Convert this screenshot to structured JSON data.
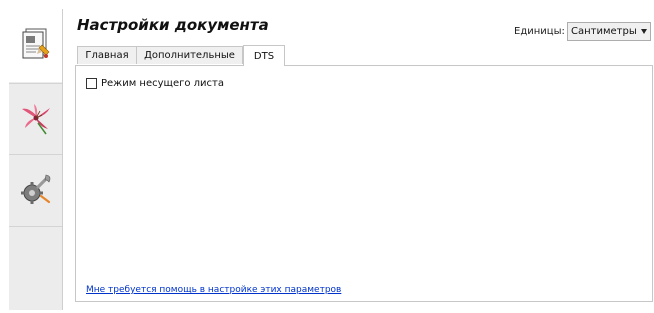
{
  "header": {
    "title": "Настройки документа",
    "units_label": "Единицы:",
    "units_value": "Сантиметры"
  },
  "tabs": [
    {
      "label": "Главная",
      "active": false
    },
    {
      "label": "Дополнительные",
      "active": false
    },
    {
      "label": "DTS",
      "active": true
    }
  ],
  "side_tabs": [
    {
      "icon": "document-icon",
      "active": true
    },
    {
      "icon": "lily-flower-icon",
      "active": false
    },
    {
      "icon": "gear-wrench-icon",
      "active": false
    }
  ],
  "panel": {
    "checkbox_label": "Режим несущего листа",
    "checkbox_checked": false,
    "help_link": "Мне требуется помощь в настройке этих параметров"
  },
  "colors": {
    "link": "#0033cc",
    "sidebar_bg": "#ececec",
    "tab_bg": "#f0f0f0"
  }
}
